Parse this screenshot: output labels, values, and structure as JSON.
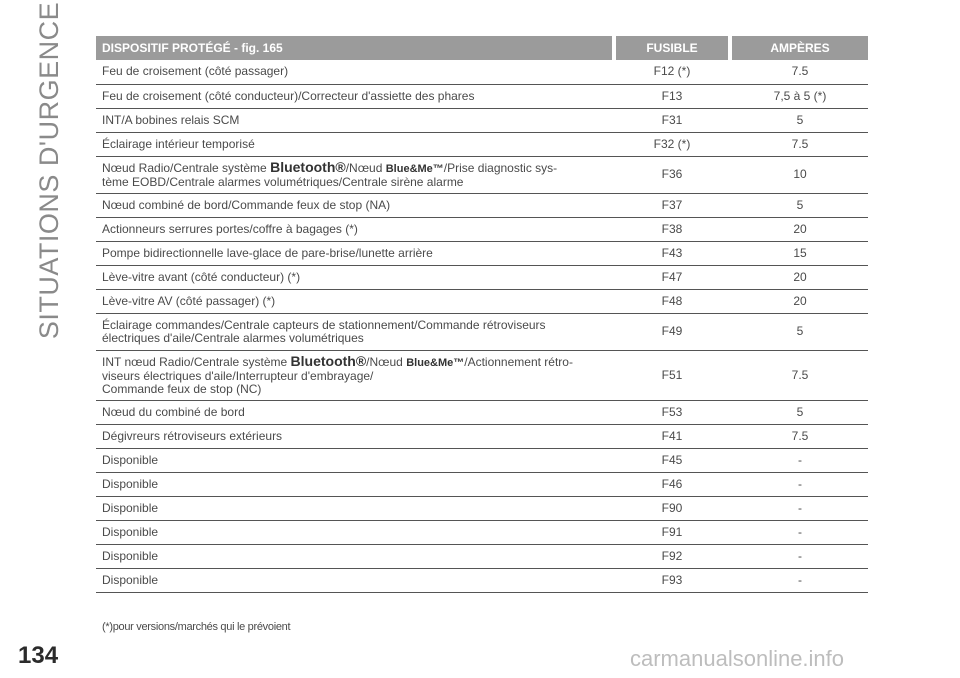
{
  "side_title": "SITUATIONS D'URGENCE",
  "page_number": "134",
  "watermark": "carmanualsonline.info",
  "table": {
    "headers": {
      "device": "DISPOSITIF PROTÉGÉ - fig. 165",
      "fuse": "FUSIBLE",
      "amperes": "AMPÈRES"
    },
    "rows": [
      {
        "device": "Feu de croisement (côté passager)",
        "fuse": "F12 (*)",
        "amperes": "7.5"
      },
      {
        "device": "Feu de croisement (côté conducteur)/Correcteur d'assiette des phares",
        "fuse": "F13",
        "amperes": "7,5 à 5 (*)"
      },
      {
        "device": "INT/A bobines relais SCM",
        "fuse": "F31",
        "amperes": "5"
      },
      {
        "device": "Éclairage intérieur temporisé",
        "fuse": "F32 (*)",
        "amperes": "7.5"
      },
      {
        "device_parts": {
          "a": "Nœud Radio/Centrale système ",
          "b": "Bluetooth®",
          "c": "/Nœud ",
          "d": "Blue&Me™",
          "e": "/Prise diagnostic sys-",
          "f": "tème EOBD/Centrale alarmes volumétriques/Centrale sirène alarme"
        },
        "fuse": "F36",
        "amperes": "10"
      },
      {
        "device": "Nœud combiné de bord/Commande feux de stop (NA)",
        "fuse": "F37",
        "amperes": "5"
      },
      {
        "device": "Actionneurs serrures portes/coffre à bagages (*)",
        "fuse": "F38",
        "amperes": "20"
      },
      {
        "device": "Pompe bidirectionnelle lave-glace de pare-brise/lunette arrière",
        "fuse": "F43",
        "amperes": "15"
      },
      {
        "device": "Lève-vitre avant (côté conducteur) (*)",
        "fuse": "F47",
        "amperes": "20"
      },
      {
        "device": "Lève-vitre AV (côté passager) (*)",
        "fuse": "F48",
        "amperes": "20"
      },
      {
        "device_lines": {
          "a": "Éclairage commandes/Centrale capteurs de stationnement/Commande rétroviseurs",
          "b": "électriques d'aile/Centrale alarmes volumétriques"
        },
        "fuse": "F49",
        "amperes": "5"
      },
      {
        "device_parts": {
          "a": "INT nœud Radio/Centrale système ",
          "b": "Bluetooth®",
          "c": "/Nœud ",
          "d": "Blue&Me™",
          "e": "/Actionnement rétro-",
          "f": "viseurs électriques d'aile/Interrupteur d'embrayage/",
          "g": "Commande feux de stop (NC)"
        },
        "fuse": "F51",
        "amperes": "7.5"
      },
      {
        "device": "Nœud du combiné de bord",
        "fuse": "F53",
        "amperes": "5"
      },
      {
        "device": "Dégivreurs rétroviseurs extérieurs",
        "fuse": "F41",
        "amperes": "7.5"
      },
      {
        "device": "Disponible",
        "fuse": "F45",
        "amperes": "-"
      },
      {
        "device": "Disponible",
        "fuse": "F46",
        "amperes": "-"
      },
      {
        "device": "Disponible",
        "fuse": "F90",
        "amperes": "-"
      },
      {
        "device": "Disponible",
        "fuse": "F91",
        "amperes": "-"
      },
      {
        "device": "Disponible",
        "fuse": "F92",
        "amperes": "-"
      },
      {
        "device": "Disponible",
        "fuse": "F93",
        "amperes": "-"
      }
    ]
  },
  "footnote": "(*)pour versions/marchés qui le prévoient"
}
